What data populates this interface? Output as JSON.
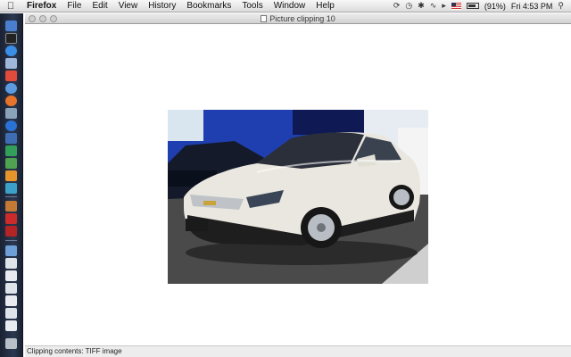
{
  "menubar": {
    "apple_icon": "apple-icon",
    "app_name": "Firefox",
    "items": [
      "File",
      "Edit",
      "View",
      "History",
      "Bookmarks",
      "Tools",
      "Window",
      "Help"
    ],
    "battery_text": "(91%)",
    "clock": "Fri 4:53 PM"
  },
  "window": {
    "title": "Picture clipping 10",
    "status": "Clipping contents: TIFF image"
  },
  "colors": {
    "dock_bg": "#2c3850",
    "menubar_bg": "#e6e6e6",
    "car_body": "#e9e7df",
    "showroom_blue": "#1f3fb0"
  }
}
